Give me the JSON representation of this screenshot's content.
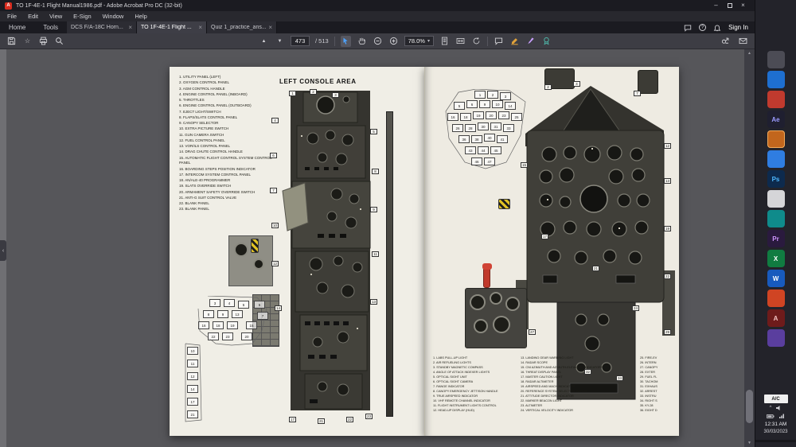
{
  "window": {
    "title": "TO 1F-4E-1 Flight Manual1986.pdf - Adobe Acrobat Pro DC (32-bit)",
    "menu": [
      "File",
      "Edit",
      "View",
      "E-Sign",
      "Window",
      "Help"
    ]
  },
  "icons": {
    "star": "☆",
    "page_up": "▲",
    "page_down": "▼",
    "caret_down": "▾",
    "close_tab": "×",
    "minimize": "–",
    "close": "×",
    "help": "?",
    "rail_toggle": "‹",
    "scroll_up": "▲",
    "scroll_down": "▼",
    "tray_caret": "^"
  },
  "tabs": {
    "home": "Home",
    "tools": "Tools",
    "sign_in": "Sign In",
    "documents": [
      {
        "label": "DCS F/A-18C Horn..."
      },
      {
        "label": "TO 1F-4E-1 Flight ..."
      },
      {
        "label": "Quiz 1_practice_ans..."
      }
    ]
  },
  "toolbar": {
    "page_current": "473",
    "page_total": "/ 513",
    "zoom_level": "78.0%"
  },
  "document": {
    "heading": "LEFT CONSOLE AREA",
    "legend_left": [
      "1. UTILITY PANEL (LEFT)",
      "2. OXYGEN CONTROL PANEL",
      "3. AGM CONTROL HANDLE",
      "4. ENGINE CONTROL PANEL (INBOARD)",
      "5. THROTTLES",
      "6. ENGINE CONTROL PANEL (OUTBOARD)",
      "7. EJECT LIGHT/SWITCH",
      "8. FLAPS/SLATS CONTROL PANEL",
      "9. CANOPY SELECTOR",
      "10. EXTRA PICTURE SWITCH",
      "11. GUN CAMERA SWITCH",
      "12. FUEL CONTROL PANEL",
      "13. VOR/ILS CONTROL PANEL",
      "14. DRAG CHUTE CONTROL HANDLE",
      "15. AUTOMATIC FLIGHT CONTROL SYSTEM CONTROL PANEL",
      "16. BOARDING STEPS POSITION INDICATOR",
      "17. INTERCOM SYSTEM CONTROL PANEL",
      "18. AN/ALE-40 PROGRAMMER",
      "19. SLATS OVERRIDE SWITCH",
      "20. ARMAMENT SAFETY OVERRIDE SWITCH",
      "21. ANTI-G SUIT CONTROL VALVE",
      "22. BLANK PANEL",
      "23. BLANK PANEL"
    ],
    "legend_right_col1": [
      "1. LABS PULL-UP LIGHT",
      "2. AIR REFUELING LIGHTS",
      "3. STANDBY MAGNETIC COMPASS",
      "4. ANGLE OF ATTACK INDEXER LIGHTS",
      "5. OPTICAL SIGHT UNIT",
      "6. OPTICAL SIGHT CAMERA",
      "7. RANGE INDICATOR",
      "8. CANOPY EMERGENCY JETTISON HANDLE",
      "9. TRUE AIRSPEED INDICATOR",
      "10. VHF REMOTE CHANNEL INDICATOR",
      "11. FLIGHT INSTRUMENT LIGHTS CONTROL",
      "12. HEAD-UP DISPLAY (HUD)"
    ],
    "legend_right_col2": [
      "13. LANDING GEAR WARNING LIGHT",
      "14. RADAR SCOPE",
      "15. CNI AZIMUTH AND AZIMUTH-ELEVATION INDICATORS",
      "16. THREAT DISPLAY PANEL",
      "17. MASTER CAUTION LIGHT",
      "18. RADAR ALTIMETER",
      "19. AIRSPEED AND MACH INDICATOR",
      "20. REFERENCE SYSTEM SELECTOR SWITCH",
      "21. ATTITUDE DIRECTOR INDICATOR",
      "22. MARKER BEACON LIGHT",
      "23. ALTIMETER",
      "24. VERTICAL VELOCITY INDICATOR"
    ],
    "legend_right_col3": [
      "25. FIRE-EV",
      "26. INTERN",
      "27. CANOPY",
      "28. EXTER",
      "29. FUEL FL",
      "30. TACHOM",
      "31. EXHAUS",
      "32. ARREST",
      "33. INSTRU",
      "34. RIGHT S",
      "35. KY-28",
      "36. EIGHT D"
    ],
    "callouts_console": [
      {
        "n": "1",
        "style": "left:150px;top:30px"
      },
      {
        "n": "2",
        "style": "left:176px;top:28px"
      },
      {
        "n": "3",
        "style": "left:204px;top:32px"
      },
      {
        "n": "4",
        "style": "left:128px;top:64px"
      },
      {
        "n": "5",
        "style": "left:252px;top:78px"
      },
      {
        "n": "6",
        "style": "left:126px;top:108px"
      },
      {
        "n": "7",
        "style": "left:126px;top:152px"
      },
      {
        "n": "8",
        "style": "left:254px;top:128px"
      },
      {
        "n": "9",
        "style": "left:252px;top:176px"
      },
      {
        "n": "10",
        "style": "left:128px;top:196px"
      },
      {
        "n": "11",
        "style": "left:254px;top:232px"
      },
      {
        "n": "12",
        "style": "left:128px;top:244px"
      },
      {
        "n": "13",
        "style": "left:252px;top:292px"
      },
      {
        "n": "14",
        "style": "left:132px;top:300px"
      },
      {
        "n": "17",
        "style": "left:150px;top:440px"
      },
      {
        "n": "21",
        "style": "left:186px;top:442px"
      },
      {
        "n": "22",
        "style": "left:222px;top:440px"
      },
      {
        "n": "23",
        "style": "left:246px;top:436px"
      }
    ],
    "callouts_panel": [
      {
        "n": "2",
        "style": "left:150px;top:22px"
      },
      {
        "n": "4",
        "style": "left:186px;top:18px"
      },
      {
        "n": "7",
        "style": "left:262px;top:30px"
      },
      {
        "n": "12",
        "style": "left:300px;top:96px"
      },
      {
        "n": "13",
        "style": "left:300px;top:140px"
      },
      {
        "n": "15",
        "style": "left:120px;top:120px"
      },
      {
        "n": "17",
        "style": "left:146px;top:210px"
      },
      {
        "n": "19",
        "style": "left:300px;top:200px"
      },
      {
        "n": "21",
        "style": "left:210px;top:250px"
      },
      {
        "n": "22",
        "style": "left:300px;top:260px"
      },
      {
        "n": "24",
        "style": "left:260px;top:300px"
      },
      {
        "n": "27",
        "style": "left:130px;top:330px"
      },
      {
        "n": "29",
        "style": "left:300px;top:330px"
      },
      {
        "n": "32",
        "style": "left:200px;top:380px"
      },
      {
        "n": "34",
        "style": "left:240px;top:388px"
      }
    ],
    "schematic_left": [
      {
        "n": "3",
        "style": "left:36px;top:4px"
      },
      {
        "n": "4",
        "style": "left:54px;top:4px"
      },
      {
        "n": "5",
        "style": "left:72px;top:6px"
      },
      {
        "n": "6",
        "style": "left:92px;top:6px"
      },
      {
        "n": "7",
        "style": "left:96px;top:20px"
      },
      {
        "n": "8",
        "style": "left:28px;top:18px"
      },
      {
        "n": "9",
        "style": "left:46px;top:18px"
      },
      {
        "n": "13",
        "style": "left:64px;top:18px"
      },
      {
        "n": "15",
        "style": "left:82px;top:32px"
      },
      {
        "n": "16",
        "style": "left:22px;top:32px"
      },
      {
        "n": "18",
        "style": "left:40px;top:32px"
      },
      {
        "n": "19",
        "style": "left:58px;top:32px"
      },
      {
        "n": "20",
        "style": "left:76px;top:46px"
      },
      {
        "n": "22",
        "style": "left:34px;top:46px"
      },
      {
        "n": "23",
        "style": "left:52px;top:46px"
      },
      {
        "n": "10",
        "style": "left:8px;top:64px"
      },
      {
        "n": "11",
        "style": "left:8px;top:80px"
      },
      {
        "n": "12",
        "style": "left:8px;top:96px"
      },
      {
        "n": "14",
        "style": "left:8px;top:112px"
      },
      {
        "n": "17",
        "style": "left:8px;top:128px"
      },
      {
        "n": "21",
        "style": "left:8px;top:144px"
      }
    ],
    "schematic_right": [
      {
        "n": "1",
        "style": "left:56px;top:2px"
      },
      {
        "n": "2",
        "style": "left:72px;top:2px"
      },
      {
        "n": "3",
        "style": "left:88px;top:4px"
      },
      {
        "n": "5",
        "style": "left:30px;top:16px"
      },
      {
        "n": "6",
        "style": "left:46px;top:14px"
      },
      {
        "n": "9",
        "style": "left:62px;top:14px"
      },
      {
        "n": "10",
        "style": "left:78px;top:14px"
      },
      {
        "n": "14",
        "style": "left:94px;top:16px"
      },
      {
        "n": "16",
        "style": "left:22px;top:30px"
      },
      {
        "n": "18",
        "style": "left:38px;top:30px"
      },
      {
        "n": "19",
        "style": "left:54px;top:28px"
      },
      {
        "n": "20",
        "style": "left:70px;top:28px"
      },
      {
        "n": "23",
        "style": "left:86px;top:28px"
      },
      {
        "n": "25",
        "style": "left:102px;top:30px"
      },
      {
        "n": "26",
        "style": "left:28px;top:44px"
      },
      {
        "n": "28",
        "style": "left:44px;top:44px"
      },
      {
        "n": "30",
        "style": "left:60px;top:42px"
      },
      {
        "n": "31",
        "style": "left:76px;top:42px"
      },
      {
        "n": "33",
        "style": "left:92px;top:44px"
      },
      {
        "n": "36",
        "style": "left:36px;top:58px"
      },
      {
        "n": "38",
        "style": "left:52px;top:58px"
      },
      {
        "n": "40",
        "style": "left:68px;top:56px"
      },
      {
        "n": "41",
        "style": "left:84px;top:58px"
      },
      {
        "n": "43",
        "style": "left:44px;top:72px"
      },
      {
        "n": "44",
        "style": "left:60px;top:72px"
      },
      {
        "n": "45",
        "style": "left:76px;top:72px"
      },
      {
        "n": "46",
        "style": "left:52px;top:86px"
      },
      {
        "n": "47",
        "style": "left:68px;top:86px"
      }
    ]
  },
  "taskbar": {
    "apps": [
      {
        "label": "",
        "style": "background:#4c4c55"
      },
      {
        "label": "",
        "style": "background:#1e6fd0"
      },
      {
        "label": "",
        "style": "background:#c03a2e"
      },
      {
        "label": "Ae",
        "style": "background:#1f1f30;color:#9a9bff"
      },
      {
        "label": "",
        "style": "background:#c2661d;box-shadow:inset 0 0 0 1px #f0a95c"
      },
      {
        "label": "",
        "style": "background:#2f7de1"
      },
      {
        "label": "Ps",
        "style": "background:#0d2a4d;color:#4db8ff"
      },
      {
        "label": "",
        "style": "background:#d5d5d8"
      },
      {
        "label": "",
        "style": "background:#0f8b8b"
      },
      {
        "label": "Pr",
        "style": "background:#2a1a3e;color:#cf96ff"
      },
      {
        "label": "X",
        "style": "background:#107c41"
      },
      {
        "label": "W",
        "style": "background:#185abd"
      },
      {
        "label": "",
        "style": "background:#d04423"
      },
      {
        "label": "A",
        "style": "background:#6e1b1b;color:#f2c2c2"
      },
      {
        "label": "",
        "style": "background:#5a3e9e"
      }
    ],
    "tray_label": "A/C",
    "time": "12:31 AM",
    "date": "30/03/2023"
  }
}
